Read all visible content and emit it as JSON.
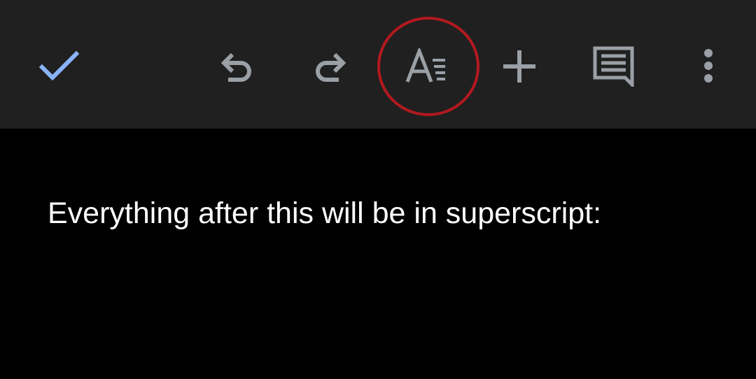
{
  "toolbar": {
    "buttons": [
      {
        "name": "done",
        "icon": "checkmark-icon",
        "color": "#8ab4f8"
      },
      {
        "name": "undo",
        "icon": "undo-icon",
        "color": "#9aa0a6"
      },
      {
        "name": "redo",
        "icon": "redo-icon",
        "color": "#9aa0a6"
      },
      {
        "name": "text-format",
        "icon": "text-format-icon",
        "color": "#9aa0a6",
        "highlighted": true,
        "highlight_color": "#b3191f"
      },
      {
        "name": "insert",
        "icon": "plus-icon",
        "color": "#9aa0a6"
      },
      {
        "name": "comment",
        "icon": "comment-icon",
        "color": "#9aa0a6"
      },
      {
        "name": "more-options",
        "icon": "vertical-dots-icon",
        "color": "#9aa0a6"
      }
    ]
  },
  "document": {
    "body_text": "Everything after this will be in superscript:"
  },
  "colors": {
    "toolbar_bg": "#202020",
    "page_bg": "#000000",
    "text": "#ffffff"
  }
}
